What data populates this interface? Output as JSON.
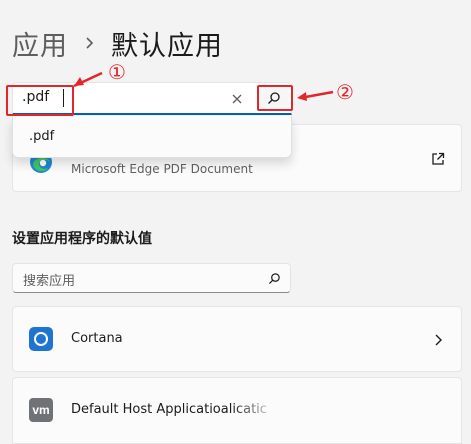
{
  "breadcrumb": {
    "parent": "应用",
    "current": "默认应用"
  },
  "search": {
    "value": ".pdf",
    "suggestion": ".pdf"
  },
  "annotations": {
    "marker1": "①",
    "marker2": "②",
    "color": "#e2262a"
  },
  "result_card": {
    "subtitle": "Microsoft Edge PDF Document",
    "icon": "edge-icon",
    "action_icon": "open-external-icon"
  },
  "section": {
    "title": "设置应用程序的默认值"
  },
  "app_search": {
    "placeholder": "搜索应用"
  },
  "apps": [
    {
      "label": "Cortana",
      "icon": "cortana-icon"
    },
    {
      "label": "Default Host Applicatioalicatic",
      "icon": "vmware-icon",
      "icon_text": "vm"
    }
  ],
  "colors": {
    "accent": "#005fb8",
    "background": "#f3f3f3",
    "card": "#fbfbfb"
  }
}
